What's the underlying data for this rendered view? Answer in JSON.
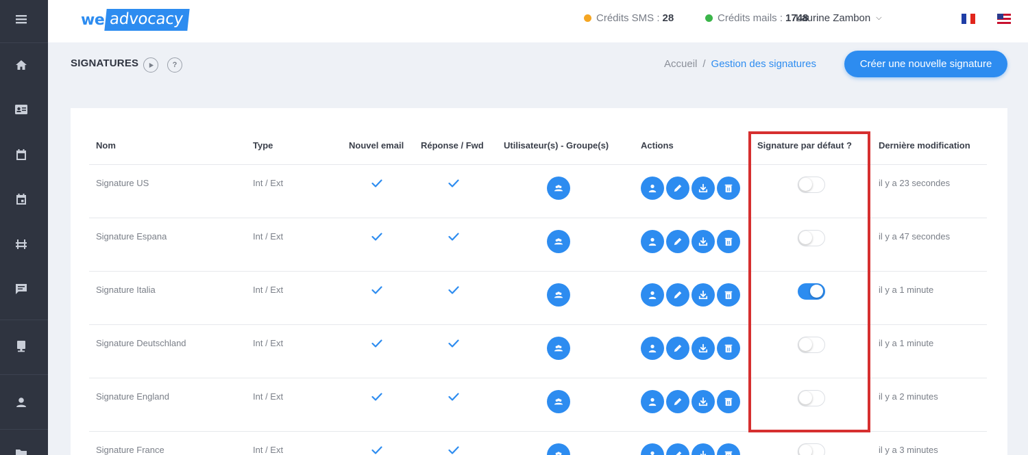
{
  "header": {
    "logo_we": "we",
    "logo_word": "advocacy",
    "sms_label": "Crédits SMS :",
    "sms_value": "28",
    "mail_label": "Crédits mails :",
    "mail_value": "1748",
    "user_name": "Laurine Zambon",
    "colors": {
      "sms_dot": "#f5a623",
      "mail_dot": "#3bb54a"
    }
  },
  "page": {
    "title": "SIGNATURES",
    "help_mark": "?",
    "breadcrumb_home": "Accueil",
    "breadcrumb_sep": "/",
    "breadcrumb_current": "Gestion des signatures",
    "create_button": "Créer une nouvelle signature"
  },
  "table": {
    "headers": {
      "name": "Nom",
      "type": "Type",
      "new_email": "Nouvel email",
      "reply": "Réponse / Fwd",
      "users": "Utilisateur(s) - Groupe(s)",
      "actions": "Actions",
      "default": "Signature par défaut ?",
      "modified": "Dernière modification"
    },
    "rows": [
      {
        "name": "Signature US",
        "type": "Int / Ext",
        "default": false,
        "modified": "il y a 23 secondes"
      },
      {
        "name": "Signature Espana",
        "type": "Int / Ext",
        "default": false,
        "modified": "il y a 47 secondes"
      },
      {
        "name": "Signature Italia",
        "type": "Int / Ext",
        "default": true,
        "modified": "il y a 1 minute"
      },
      {
        "name": "Signature Deutschland",
        "type": "Int / Ext",
        "default": false,
        "modified": "il y a 1 minute"
      },
      {
        "name": "Signature England",
        "type": "Int / Ext",
        "default": false,
        "modified": "il y a 2 minutes"
      },
      {
        "name": "Signature France",
        "type": "Int / Ext",
        "default": false,
        "modified": "il y a 3 minutes"
      }
    ]
  },
  "theme": {
    "accent": "#2d8cf0",
    "sidebar": "#2f3440",
    "highlight": "#d62f2f"
  }
}
